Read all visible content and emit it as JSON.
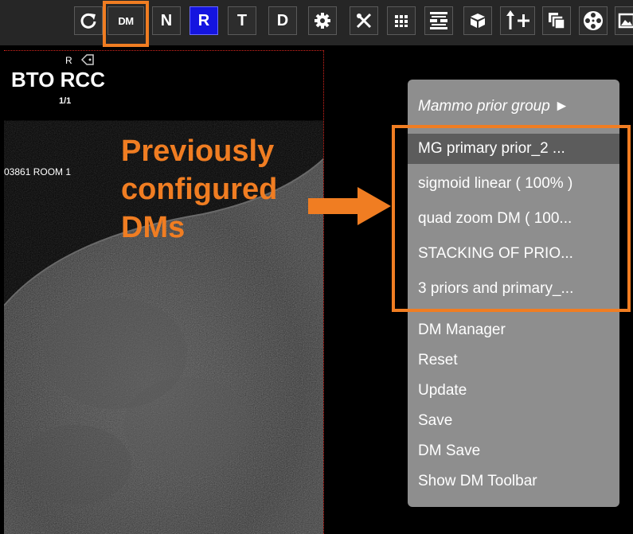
{
  "toolbar": {
    "buttons": [
      {
        "name": "refresh-button",
        "icon": "refresh-icon"
      },
      {
        "name": "dm-button",
        "label": "DM"
      },
      {
        "name": "n-button",
        "label": "N"
      },
      {
        "name": "r-button",
        "label": "R"
      },
      {
        "name": "t-button",
        "label": "T"
      },
      {
        "name": "d-button",
        "label": "D"
      },
      {
        "name": "settings-button",
        "icon": "gear-icon"
      },
      {
        "name": "tools-button",
        "icon": "crossed-tools-icon"
      },
      {
        "name": "layout-grid-button",
        "icon": "grid-icon"
      },
      {
        "name": "hanging-protocol-button",
        "icon": "stack-slider-icon"
      },
      {
        "name": "3d-button",
        "icon": "cube-icon"
      },
      {
        "name": "arrow-plus-button",
        "icon": "arrow-plus-icon"
      },
      {
        "name": "series-button",
        "icon": "overlapping-windows-icon"
      },
      {
        "name": "cine-button",
        "icon": "film-reel-icon"
      },
      {
        "name": "image-button",
        "icon": "picture-icon"
      }
    ],
    "dm_label": "DM",
    "n_label": "N",
    "r_label": "R",
    "t_label": "T",
    "d_label": "D",
    "accent": "#f07d22",
    "r_color": "#1414e0"
  },
  "viewport": {
    "laterality": "R",
    "title": "BTO RCC",
    "image_count": "1/1",
    "station_text": "03861 ROOM 1",
    "frame_color": "#d8261e"
  },
  "annotation": {
    "lines": [
      "Previously",
      "configured",
      "DMs"
    ],
    "color": "#f07d22"
  },
  "menu": {
    "group_label": "Mammo prior group ►",
    "dm_items": [
      "MG primary prior_2 ...",
      "sigmoid linear ( 100% )",
      "quad zoom DM ( 100...",
      "STACKING OF PRIO...",
      "3 priors and primary_..."
    ],
    "actions": [
      "DM Manager",
      "Reset",
      "Update",
      "Save",
      "DM Save",
      "Show DM Toolbar"
    ],
    "bg": "#8e8e8e",
    "selected_bg": "#5c5c5c"
  }
}
